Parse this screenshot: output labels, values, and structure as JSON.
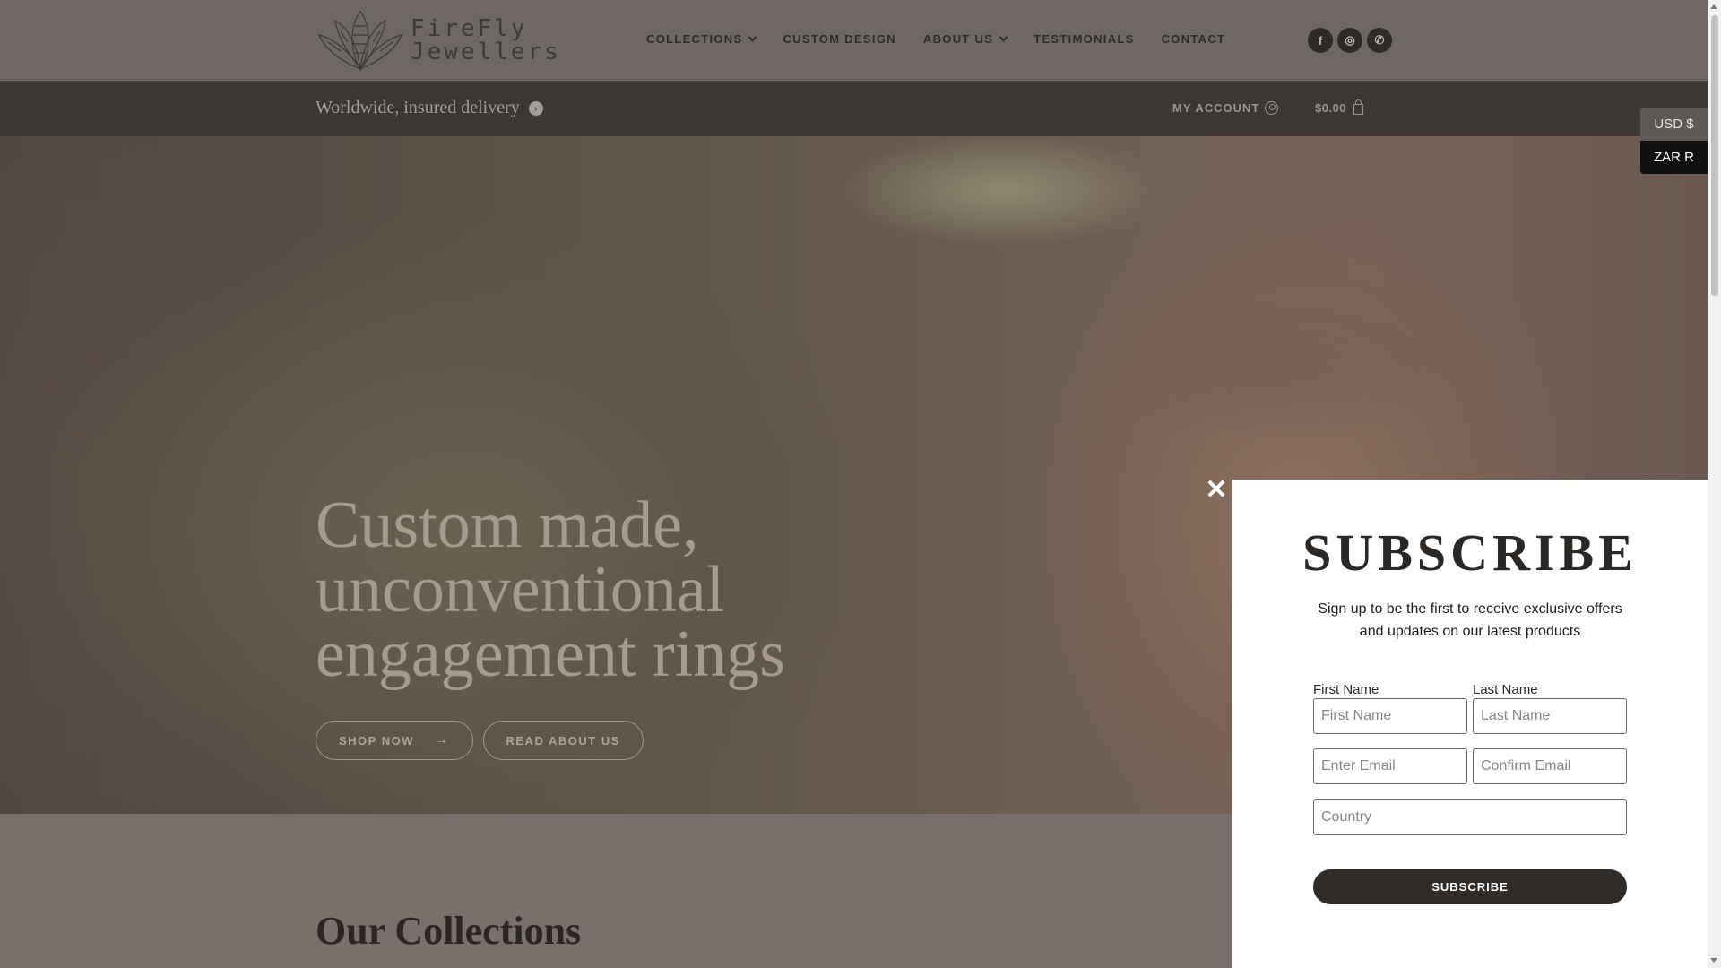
{
  "header": {
    "logo": {
      "line1": "FireFly",
      "line2": "Jewellers",
      "icon": "lotus-logo-icon"
    },
    "nav": [
      {
        "label": "COLLECTIONS",
        "dropdown": true
      },
      {
        "label": "CUSTOM DESIGN",
        "dropdown": false
      },
      {
        "label": "ABOUT US",
        "dropdown": true
      },
      {
        "label": "TESTIMONIALS",
        "dropdown": false
      },
      {
        "label": "CONTACT",
        "dropdown": false
      }
    ],
    "socials": [
      {
        "icon": "facebook-icon",
        "glyph": "f"
      },
      {
        "icon": "instagram-icon",
        "glyph": "◎"
      },
      {
        "icon": "whatsapp-icon",
        "glyph": "✆"
      }
    ]
  },
  "subbar": {
    "delivery_text": "Worldwide, insured delivery",
    "account_label": "MY ACCOUNT",
    "cart_total": "$0.00"
  },
  "currency": {
    "options": [
      "USD $",
      "ZAR R"
    ],
    "selected": "USD $"
  },
  "hero": {
    "title_lines": [
      "Custom made,",
      "unconventional",
      "engagement rings"
    ],
    "shop_label": "SHOP NOW",
    "about_label": "READ ABOUT US"
  },
  "collections": {
    "title": "Our Collections"
  },
  "popup": {
    "title": "SUBSCRIBE",
    "description": "Sign up to be the first to receive exclusive offers and updates on our latest products",
    "first_name_label": "First Name",
    "last_name_label": "Last Name",
    "first_name_placeholder": "First Name",
    "last_name_placeholder": "Last Name",
    "email_placeholder": "Enter Email",
    "confirm_email_placeholder": "Confirm Email",
    "country_placeholder": "Country",
    "button_label": "SUBSCRIBE",
    "close_glyph": "✕"
  },
  "colors": {
    "header_bg": "#6e6763",
    "subbar_bg": "#3b3733",
    "overlay": "#7a6f6a",
    "button_dark": "#2f2c2a",
    "currency_active": "#111010"
  }
}
